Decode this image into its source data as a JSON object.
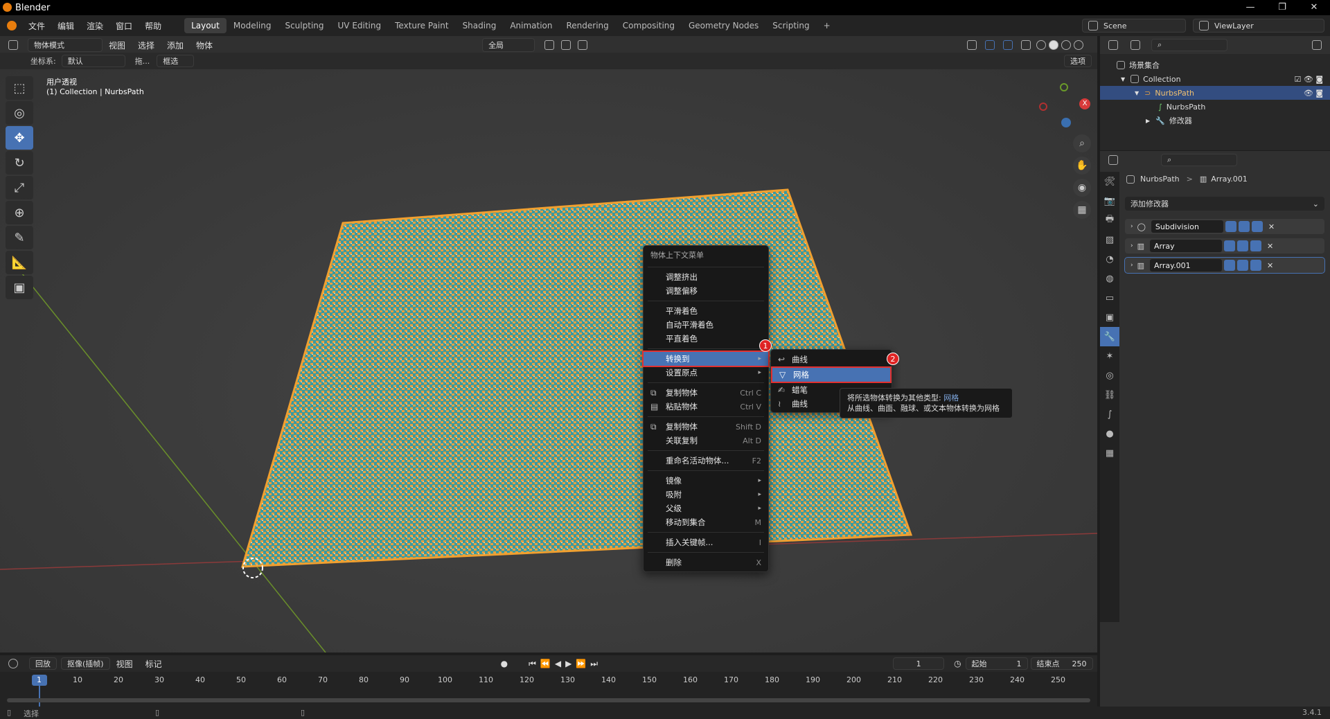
{
  "window": {
    "title": "Blender",
    "controls": [
      "—",
      "❐",
      "✕"
    ]
  },
  "menubar": {
    "menus": [
      "文件",
      "编辑",
      "渲染",
      "窗口",
      "帮助"
    ],
    "workspaces": [
      "Layout",
      "Modeling",
      "Sculpting",
      "UV Editing",
      "Texture Paint",
      "Shading",
      "Animation",
      "Rendering",
      "Compositing",
      "Geometry Nodes",
      "Scripting"
    ],
    "add_tab": "+",
    "scene": "Scene",
    "view_layer": "ViewLayer"
  },
  "viewport_header": {
    "mode": "物体模式",
    "menus": [
      "视图",
      "选择",
      "添加",
      "物体"
    ],
    "transform_orientation": "全局",
    "coord_label": "坐标系:",
    "coord_value": "默认",
    "drag_label": "拖...",
    "select_mode": "框选",
    "options": "选项"
  },
  "viewport": {
    "view_name": "用户透视",
    "collection_info": "(1) Collection | NurbsPath",
    "gizmo_axes": [
      "X",
      "Y",
      "Z"
    ]
  },
  "tools": [
    "select-box",
    "cursor",
    "move",
    "rotate",
    "scale",
    "transform",
    "annotate",
    "measure",
    "add-cube"
  ],
  "context_menu": {
    "title": "物体上下文菜单",
    "items": [
      {
        "label": "调整挤出",
        "shortcut": ""
      },
      {
        "label": "调整偏移",
        "shortcut": ""
      },
      {
        "label": "平滑着色",
        "shortcut": ""
      },
      {
        "label": "自动平滑着色",
        "shortcut": ""
      },
      {
        "label": "平直着色",
        "shortcut": ""
      },
      {
        "label": "转换到",
        "shortcut": "▸"
      },
      {
        "label": "设置原点",
        "shortcut": "▸"
      },
      {
        "label": "复制物体",
        "shortcut": "Ctrl C"
      },
      {
        "label": "粘贴物体",
        "shortcut": "Ctrl V"
      },
      {
        "label": "复制物体",
        "shortcut": "Shift D"
      },
      {
        "label": "关联复制",
        "shortcut": "Alt D"
      },
      {
        "label": "重命名活动物体...",
        "shortcut": "F2"
      },
      {
        "label": "镜像",
        "shortcut": "▸"
      },
      {
        "label": "吸附",
        "shortcut": "▸"
      },
      {
        "label": "父级",
        "shortcut": "▸"
      },
      {
        "label": "移动到集合",
        "shortcut": "M"
      },
      {
        "label": "插入关键帧...",
        "shortcut": "I"
      },
      {
        "label": "删除",
        "shortcut": "X"
      }
    ]
  },
  "convert_submenu": {
    "items": [
      "曲线",
      "网格",
      "蜡笔",
      "曲线"
    ],
    "badge_1": "1",
    "badge_2": "2"
  },
  "tooltip": {
    "line1_prefix": "将所选物体转换为其他类型: ",
    "line1_value": "网格",
    "line2": "从曲线、曲面、融球、或文本物体转换为网格"
  },
  "outliner": {
    "root": "场景集合",
    "collection": "Collection",
    "object": "NurbsPath",
    "data": "NurbsPath",
    "modifiers": "修改器"
  },
  "properties": {
    "breadcrumb_object": "NurbsPath",
    "breadcrumb_sep": ">",
    "breadcrumb_modifier": "Array.001",
    "add_modifier": "添加修改器",
    "modifiers": [
      "Subdivision",
      "Array",
      "Array.001"
    ]
  },
  "timeline": {
    "playback": "回放",
    "keying": "抠像(插帧)",
    "view": "视图",
    "marker": "标记",
    "current_frame": "1",
    "start_label": "起始",
    "start": "1",
    "end_label": "结束点",
    "end": "250",
    "ticks": [
      "1",
      "10",
      "20",
      "30",
      "40",
      "50",
      "60",
      "70",
      "80",
      "90",
      "100",
      "110",
      "120",
      "130",
      "140",
      "150",
      "160",
      "170",
      "180",
      "190",
      "200",
      "210",
      "220",
      "230",
      "240",
      "250"
    ]
  },
  "statusbar": {
    "left": "选择",
    "version": "3.4.1"
  },
  "colors": {
    "accent": "#4772b3",
    "highlight_border": "#e23030",
    "mesh_orange": "#e8a040",
    "mesh_teal": "#3a9aa0"
  }
}
